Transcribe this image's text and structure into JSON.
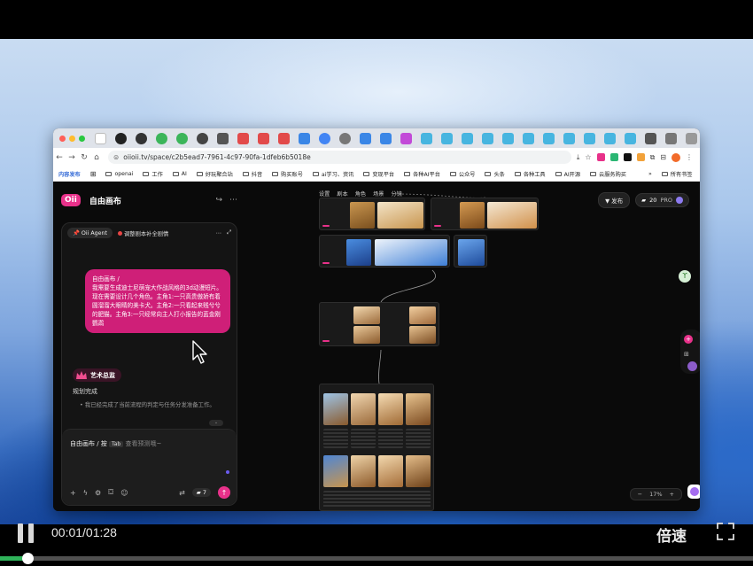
{
  "browser": {
    "url": "oiioii.tv/space/c2b5ead7-7961-4c97-90fa-1dfeb6b5018e",
    "bookmarks": [
      {
        "label": "内容发布",
        "kind": "text"
      },
      {
        "label": "openai",
        "kind": "folder"
      },
      {
        "label": "工作",
        "kind": "folder"
      },
      {
        "label": "AI",
        "kind": "folder"
      },
      {
        "label": "好玩聚合站",
        "kind": "folder"
      },
      {
        "label": "抖音",
        "kind": "folder"
      },
      {
        "label": "购买账号",
        "kind": "folder"
      },
      {
        "label": "ai学习、资讯",
        "kind": "folder"
      },
      {
        "label": "变现平台",
        "kind": "folder"
      },
      {
        "label": "各种AI平台",
        "kind": "folder"
      },
      {
        "label": "公众号",
        "kind": "folder"
      },
      {
        "label": "头条",
        "kind": "folder"
      },
      {
        "label": "各种工具",
        "kind": "folder"
      },
      {
        "label": "AI开源",
        "kind": "folder"
      },
      {
        "label": "云服务购买",
        "kind": "folder"
      }
    ],
    "bookmarks_more": "»",
    "all_bookmarks": "所有书签"
  },
  "left_panel": {
    "logo": "Oii",
    "title": "自由画布",
    "agent_label": "Oii Agent",
    "agent_status": "调整剧本补全剧情",
    "message": "自由画布 / \n我需要生成迪士尼萌宠大作战风格的3d动漫短片。现在需要设计几个角色。主角1:一只高贵傲娇有着圆溜溜大眼睛的美卡犬。主角2:一只看起来贱兮兮的肥猫。主角3:一只经常向主人打小报告的蓝金刚鹦鹉",
    "role_badge": "艺术总监",
    "plan_title": "规划完成",
    "plan_item": "我已经完成了当前流程的判定与任务分发准备工作。",
    "input_prefix": "自由画布 / 按",
    "input_key": "Tab",
    "input_hint": "查看预测哦~",
    "credits": "7"
  },
  "canvas": {
    "tabs": [
      "设置",
      "剧本",
      "角色",
      "场景",
      "分镜"
    ],
    "publish_label": "发布",
    "credit_count": "20",
    "plan_label": "PRO",
    "zoom_minus": "−",
    "zoom_level": "17%",
    "zoom_plus": "+"
  },
  "player": {
    "time": "00:01/01:28",
    "speed_label": "倍速",
    "progress": 0.036
  },
  "colors": {
    "accent": "#e8318a",
    "progress": "#2fb35a"
  }
}
